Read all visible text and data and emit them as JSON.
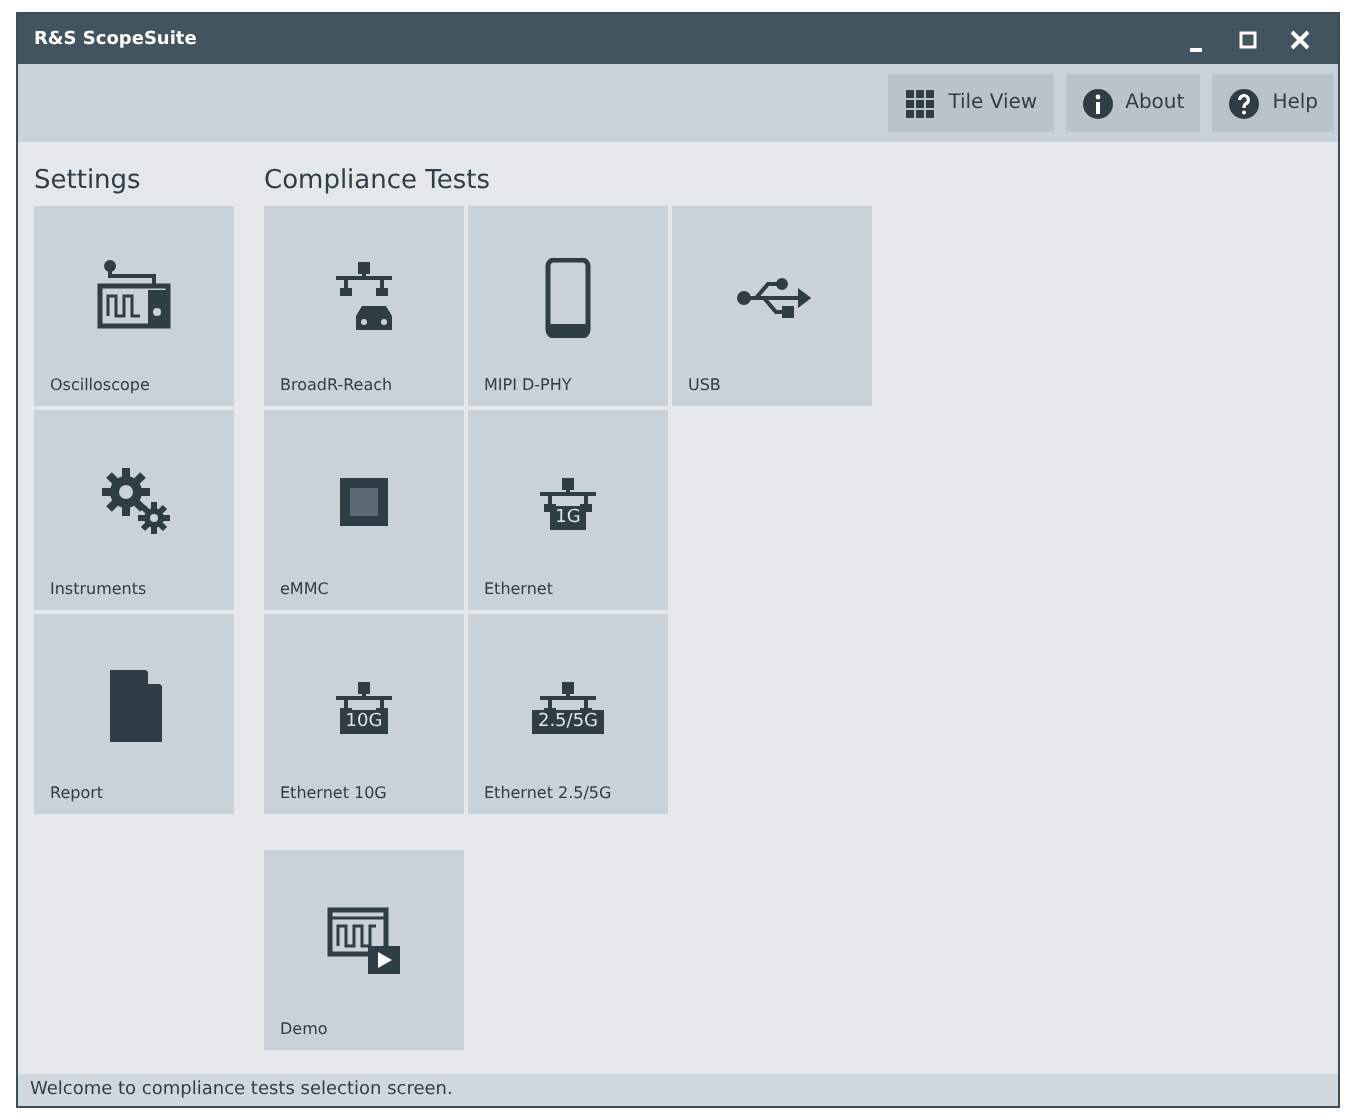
{
  "window": {
    "title": "R&S ScopeSuite"
  },
  "toolbar": [
    {
      "label": "Tile View",
      "kind": "grid"
    },
    {
      "label": "About",
      "kind": "info"
    },
    {
      "label": "Help",
      "kind": "help"
    }
  ],
  "settings": {
    "heading": "Settings",
    "tiles": [
      {
        "label": "Oscilloscope",
        "kind": "scope"
      },
      {
        "label": "Instruments",
        "kind": "gears"
      },
      {
        "label": "Report",
        "kind": "document"
      }
    ]
  },
  "compliance": {
    "heading": "Compliance Tests",
    "rows": [
      [
        {
          "label": "BroadR-Reach",
          "kind": "car-network"
        },
        {
          "label": "MIPI D-PHY",
          "kind": "phone"
        },
        {
          "label": "USB",
          "kind": "usb"
        }
      ],
      [
        {
          "label": "eMMC",
          "kind": "chip"
        },
        {
          "label": "Ethernet",
          "kind": "network",
          "badge": "1G"
        }
      ],
      [
        {
          "label": "Ethernet 10G",
          "kind": "network",
          "badge": "10G"
        },
        {
          "label": "Ethernet 2.5/5G",
          "kind": "network",
          "badge": "2.5/5G"
        }
      ],
      [
        {
          "label": "Demo",
          "kind": "demo"
        }
      ]
    ]
  },
  "status_bar": "Welcome to compliance tests selection screen."
}
